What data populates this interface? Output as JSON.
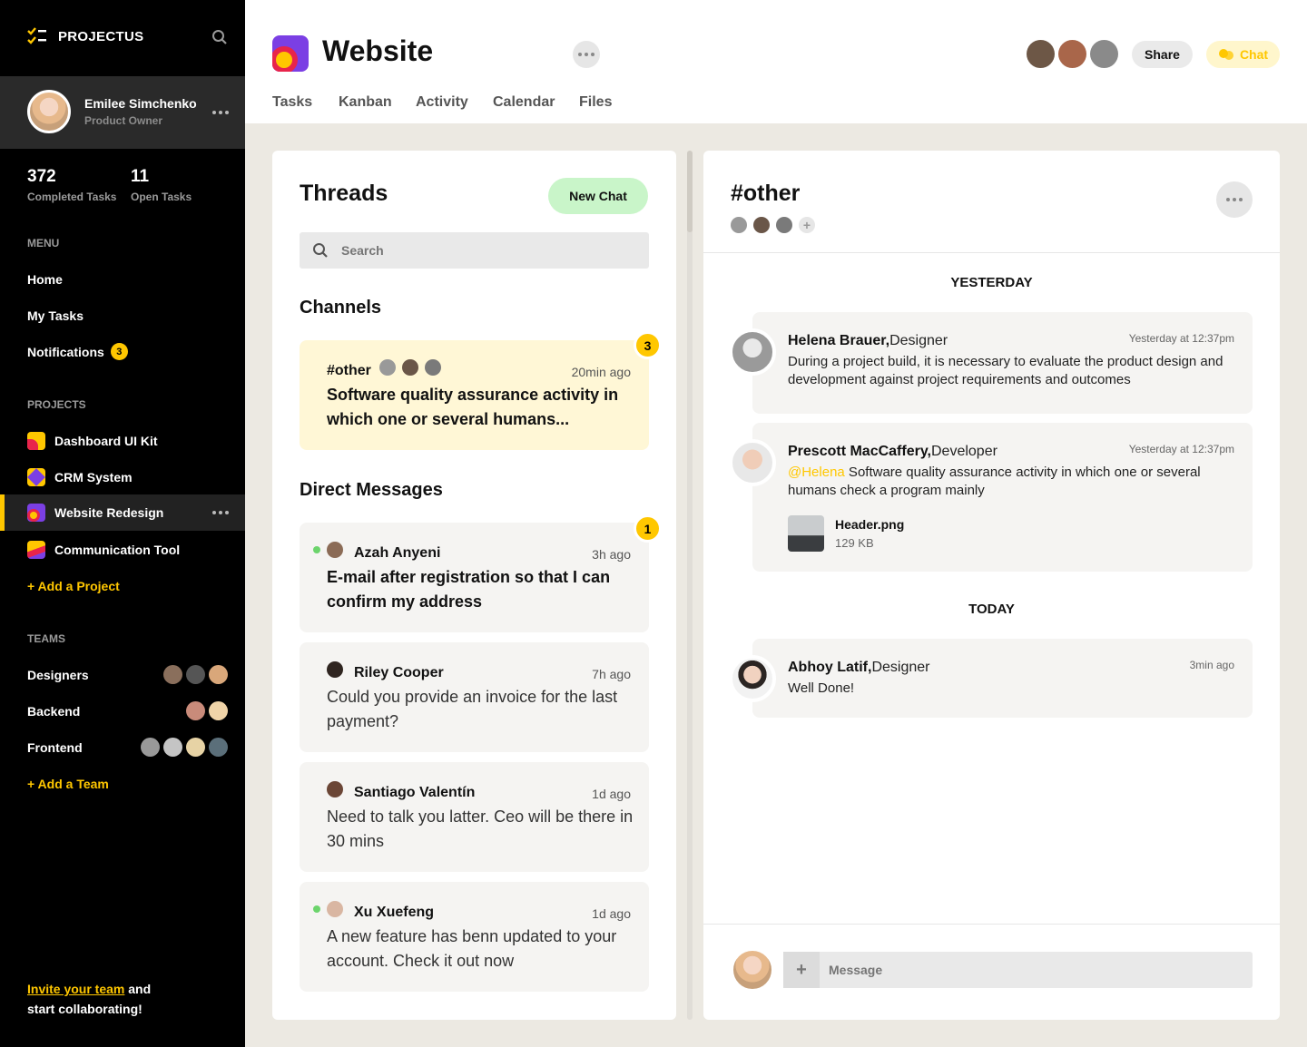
{
  "app": {
    "name": "PROJECTUS"
  },
  "colors": {
    "accent": "#FFC700",
    "sidebar": "#000000",
    "background": "#ECE9E2",
    "new_chat": "#C9F5C9",
    "active_channel": "#FFF7D6",
    "online": "#6CD46C"
  },
  "user": {
    "name": "Emilee Simchenko",
    "role": "Product Owner"
  },
  "stats": [
    {
      "value": "372",
      "label": "Completed Tasks"
    },
    {
      "value": "11",
      "label": "Open Tasks"
    }
  ],
  "menu": {
    "title": "MENU",
    "items": [
      {
        "label": "Home"
      },
      {
        "label": "My Tasks"
      },
      {
        "label": "Notifications",
        "badge": "3"
      }
    ]
  },
  "projects": {
    "title": "PROJECTS",
    "items": [
      {
        "label": "Dashboard UI Kit"
      },
      {
        "label": "CRM System"
      },
      {
        "label": "Website Redesign"
      },
      {
        "label": "Communication Tool"
      }
    ],
    "add_label": "+ Add a Project"
  },
  "teams": {
    "title": "TEAMS",
    "items": [
      {
        "label": "Designers"
      },
      {
        "label": "Backend"
      },
      {
        "label": "Frontend"
      }
    ],
    "add_label": "+ Add a Team"
  },
  "invite": {
    "link": "Invite your team",
    "rest1": " and",
    "rest2": "start collaborating!"
  },
  "header": {
    "title": "Website",
    "tabs": [
      "Tasks",
      "Kanban",
      "Activity",
      "Calendar",
      "Files"
    ],
    "share_label": "Share",
    "chat_label": "Chat"
  },
  "threads": {
    "title": "Threads",
    "new_chat_label": "New Chat",
    "search_placeholder": "Search",
    "channels_title": "Channels",
    "channel": {
      "name": "#other",
      "time": "20min ago",
      "preview": "Software quality assurance activity in which one or several humans...",
      "badge": "3"
    },
    "dm_title": "Direct Messages",
    "dms": [
      {
        "name": "Azah Anyeni",
        "time": "3h ago",
        "preview": "E-mail after registration so that I can confirm my address",
        "badge": "1",
        "online": true
      },
      {
        "name": "Riley Cooper",
        "time": "7h ago",
        "preview": "Could you provide an invoice for the last payment?"
      },
      {
        "name": "Santiago Valentín",
        "time": "1d ago",
        "preview": "Need to talk you latter. Ceo will be there in 30 mins"
      },
      {
        "name": "Xu Xuefeng",
        "time": "1d ago",
        "preview": "A new feature has benn updated to your account. Check it out now",
        "online": true
      }
    ]
  },
  "chat": {
    "channel": "#other",
    "day1": "YESTERDAY",
    "day2": "TODAY",
    "messages": [
      {
        "name": "Helena Brauer,",
        "role": "Designer",
        "time": "Yesterday at 12:37pm",
        "body": "During a project build, it is necessary to evaluate the product design and development against project requirements and outcomes"
      },
      {
        "name": "Prescott MacCaffery,",
        "role": "Developer",
        "time": "Yesterday at 12:37pm",
        "mention": "@Helena",
        "body": " Software quality assurance activity in which one or several humans check a program mainly",
        "file": {
          "name": "Header.png",
          "size": "129 KB"
        }
      },
      {
        "name": "Abhoy Latif,",
        "role": "Designer",
        "time": "3min ago",
        "body": "Well Done!"
      }
    ],
    "input_placeholder": "Message"
  }
}
